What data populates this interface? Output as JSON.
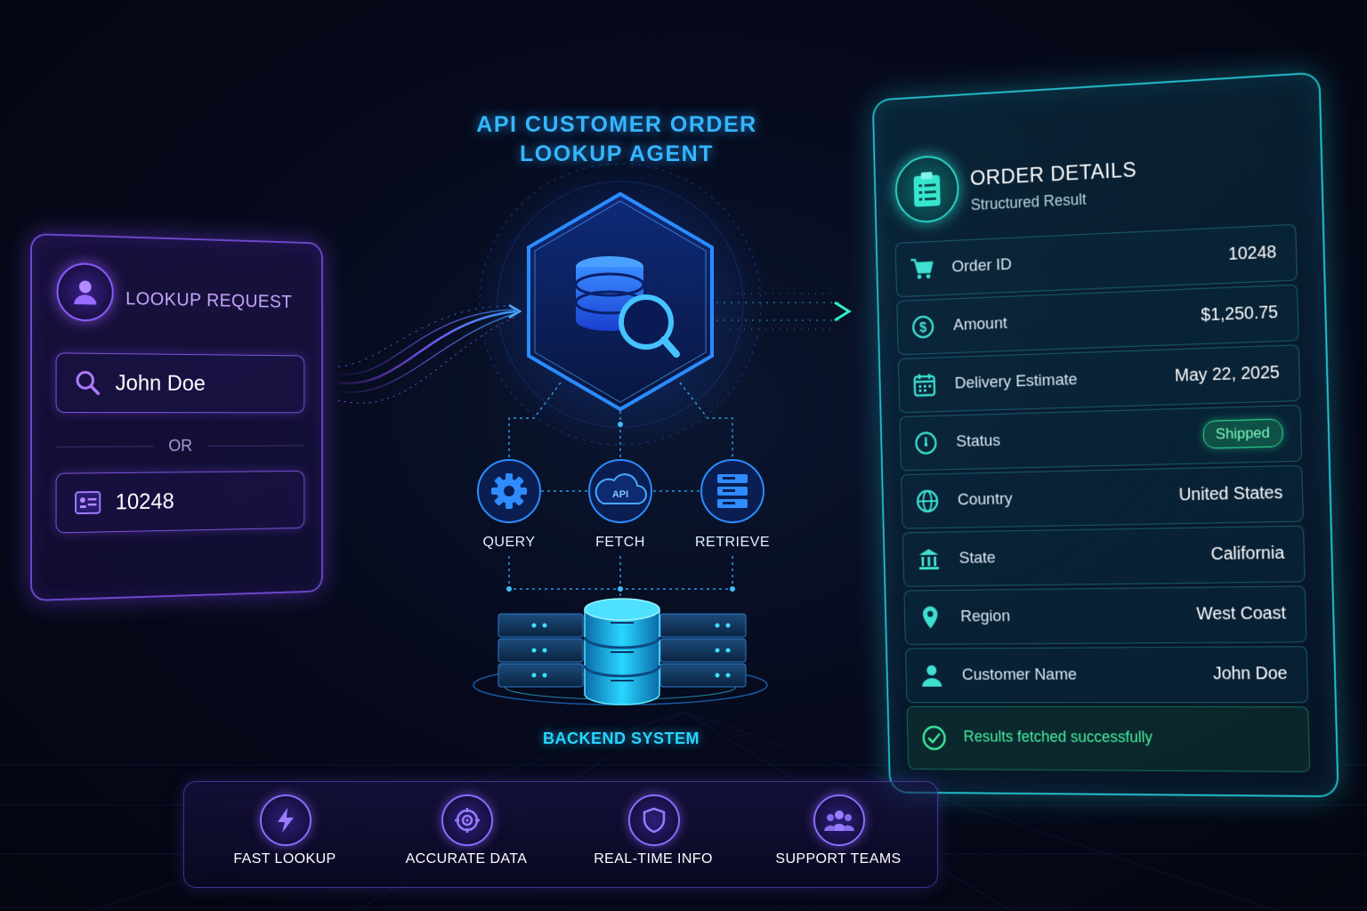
{
  "title": "API CUSTOMER ORDER LOOKUP AGENT",
  "title_line1": "API CUSTOMER ORDER",
  "title_line2": "LOOKUP AGENT",
  "lookup": {
    "title": "LOOKUP REQUEST",
    "name_value": "John Doe",
    "or_label": "OR",
    "id_value": "10248",
    "icons": [
      "user-icon",
      "search-icon",
      "id-card-icon"
    ]
  },
  "agent": {
    "icon": "database-search-icon",
    "nodes": [
      {
        "label": "QUERY",
        "icon": "gear-icon"
      },
      {
        "label": "FETCH",
        "icon": "cloud-api-icon",
        "icon_text": "API"
      },
      {
        "label": "RETRIEVE",
        "icon": "server-icon"
      }
    ],
    "backend_label": "BACKEND SYSTEM"
  },
  "order": {
    "title": "ORDER DETAILS",
    "subtitle": "Structured Result",
    "rows": [
      {
        "label": "Order ID",
        "value": "10248",
        "icon": "cart-icon"
      },
      {
        "label": "Amount",
        "value": "$1,250.75",
        "icon": "dollar-icon"
      },
      {
        "label": "Delivery Estimate",
        "value": "May 22, 2025",
        "icon": "calendar-icon"
      },
      {
        "label": "Status",
        "value": "Shipped",
        "icon": "clock-icon"
      },
      {
        "label": "Country",
        "value": "United States",
        "icon": "globe-icon"
      },
      {
        "label": "State",
        "value": "California",
        "icon": "bank-icon"
      },
      {
        "label": "Region",
        "value": "West Coast",
        "icon": "location-pin-icon"
      },
      {
        "label": "Customer Name",
        "value": "John Doe",
        "icon": "person-icon"
      }
    ],
    "success_message": "Results fetched successfully"
  },
  "features": [
    {
      "label": "FAST LOOKUP",
      "icon": "lightning-icon"
    },
    {
      "label": "ACCURATE DATA",
      "icon": "target-icon"
    },
    {
      "label": "REAL-TIME INFO",
      "icon": "shield-icon"
    },
    {
      "label": "SUPPORT TEAMS",
      "icon": "team-icon"
    }
  ],
  "colors": {
    "background": "#050818",
    "purple_accent": "#8a5cff",
    "blue_accent": "#35b6ff",
    "teal_accent": "#2fe0d0",
    "success_green": "#46f0a0"
  }
}
